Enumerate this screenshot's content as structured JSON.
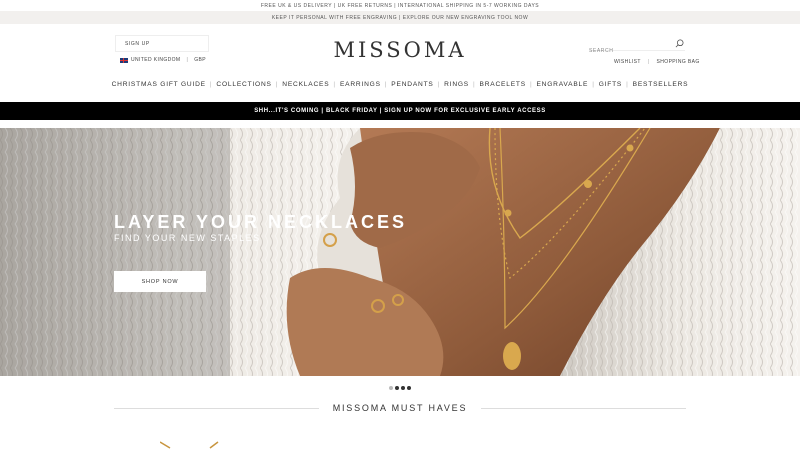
{
  "promo": {
    "line1": "FREE UK & US DELIVERY  |  UK FREE RETURNS  |  INTERNATIONAL SHIPPING IN 5-7 WORKING DAYS",
    "line2": "KEEP IT PERSONAL WITH FREE ENGRAVING | EXPLORE OUR NEW ENGRAVING TOOL NOW"
  },
  "header": {
    "signup_label": "SIGN UP",
    "country": "UNITED KINGDOM",
    "currency": "GBP",
    "logo": "MISSOMA",
    "search_placeholder": "SEARCH",
    "wishlist": "WISHLIST",
    "bag": "SHOPPING BAG",
    "icons": {
      "flag": "uk-flag-icon",
      "search": "search-icon"
    }
  },
  "nav": {
    "items": [
      {
        "label": "CHRISTMAS GIFT GUIDE"
      },
      {
        "label": "COLLECTIONS"
      },
      {
        "label": "NECKLACES"
      },
      {
        "label": "EARRINGS"
      },
      {
        "label": "PENDANTS"
      },
      {
        "label": "RINGS"
      },
      {
        "label": "BRACELETS"
      },
      {
        "label": "ENGRAVABLE"
      },
      {
        "label": "GIFTS"
      },
      {
        "label": "BESTSELLERS"
      }
    ]
  },
  "announcement": "SHH...IT'S COMING | BLACK FRIDAY | SIGN UP NOW FOR EXCLUSIVE EARLY ACCESS",
  "hero": {
    "title": "LAYER YOUR NECKLACES",
    "subtitle": "FIND YOUR NEW STAPLES",
    "cta": "SHOP NOW",
    "slides_total": 4,
    "active_slide": 1
  },
  "section": {
    "title": "MISSOMA MUST HAVES"
  },
  "colors": {
    "announce_bg": "#000000",
    "promo2_bg": "#f2f0ee",
    "gold": "#c8953e"
  }
}
